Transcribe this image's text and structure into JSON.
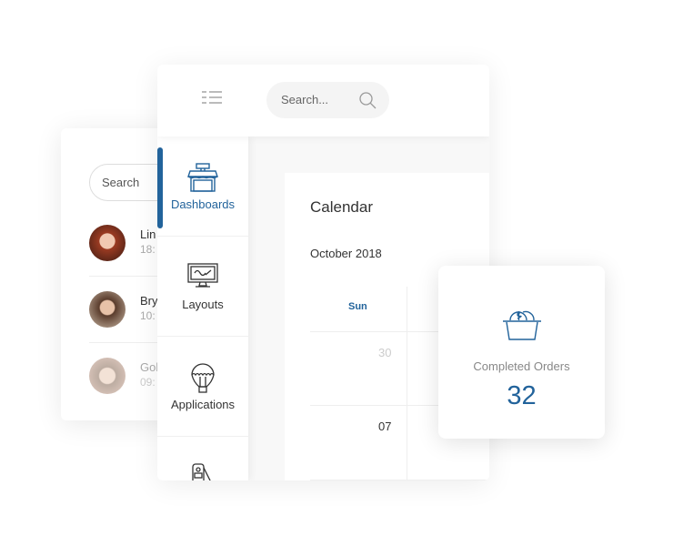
{
  "chat_panel": {
    "search_placeholder": "Search",
    "contacts": [
      {
        "name": "Lin",
        "time": "18:"
      },
      {
        "name": "Bry",
        "time": "10:"
      },
      {
        "name": "Gol",
        "time": "09:"
      }
    ]
  },
  "header": {
    "menu_icon": "list-icon",
    "search_placeholder": "Search...",
    "search_icon": "magnifier-icon"
  },
  "sidebar": {
    "items": [
      {
        "label": "Dashboards",
        "icon": "shop-icon",
        "active": true
      },
      {
        "label": "Layouts",
        "icon": "monitor-icon"
      },
      {
        "label": "Applications",
        "icon": "balloon-icon"
      },
      {
        "label": "",
        "icon": "user-badge-icon"
      }
    ]
  },
  "calendar": {
    "title": "Calendar",
    "month": "October 2018",
    "weekday": "Sun",
    "days": [
      "30",
      "07"
    ]
  },
  "stat_card": {
    "icon": "basket-icon",
    "label": "Completed Orders",
    "value": "32"
  },
  "colors": {
    "accent": "#22639b"
  }
}
